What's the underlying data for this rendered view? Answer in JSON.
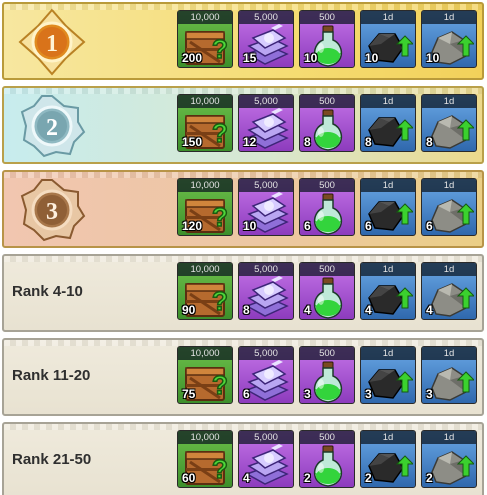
{
  "item_tags": {
    "crate": "10,000",
    "books": "5,000",
    "potion": "500",
    "coal": "1d",
    "ore": "1d"
  },
  "item_icons": {
    "crate": "mystery-crate-icon",
    "books": "skill-books-icon",
    "potion": "green-potion-icon",
    "coal": "coal-upgrade-icon",
    "ore": "iron-ore-upgrade-icon"
  },
  "rows": [
    {
      "rank": "1",
      "crate": "200",
      "books": "15",
      "potion": "10",
      "coal": "10",
      "ore": "10"
    },
    {
      "rank": "2",
      "crate": "150",
      "books": "12",
      "potion": "8",
      "coal": "8",
      "ore": "8"
    },
    {
      "rank": "3",
      "crate": "120",
      "books": "10",
      "potion": "6",
      "coal": "6",
      "ore": "6"
    },
    {
      "rank": "Rank 4-10",
      "crate": "90",
      "books": "8",
      "potion": "4",
      "coal": "4",
      "ore": "4"
    },
    {
      "rank": "Rank 11-20",
      "crate": "75",
      "books": "6",
      "potion": "3",
      "coal": "3",
      "ore": "3"
    },
    {
      "rank": "Rank 21-50",
      "crate": "60",
      "books": "4",
      "potion": "2",
      "coal": "2",
      "ore": "2"
    }
  ],
  "colors": {
    "gold": "#e8a93a",
    "silver": "#9fc7cf",
    "bronze": "#b98a5a",
    "green_slot": "#4fa535",
    "purple_slot": "#a552d3",
    "blue_slot": "#4b88cc"
  }
}
